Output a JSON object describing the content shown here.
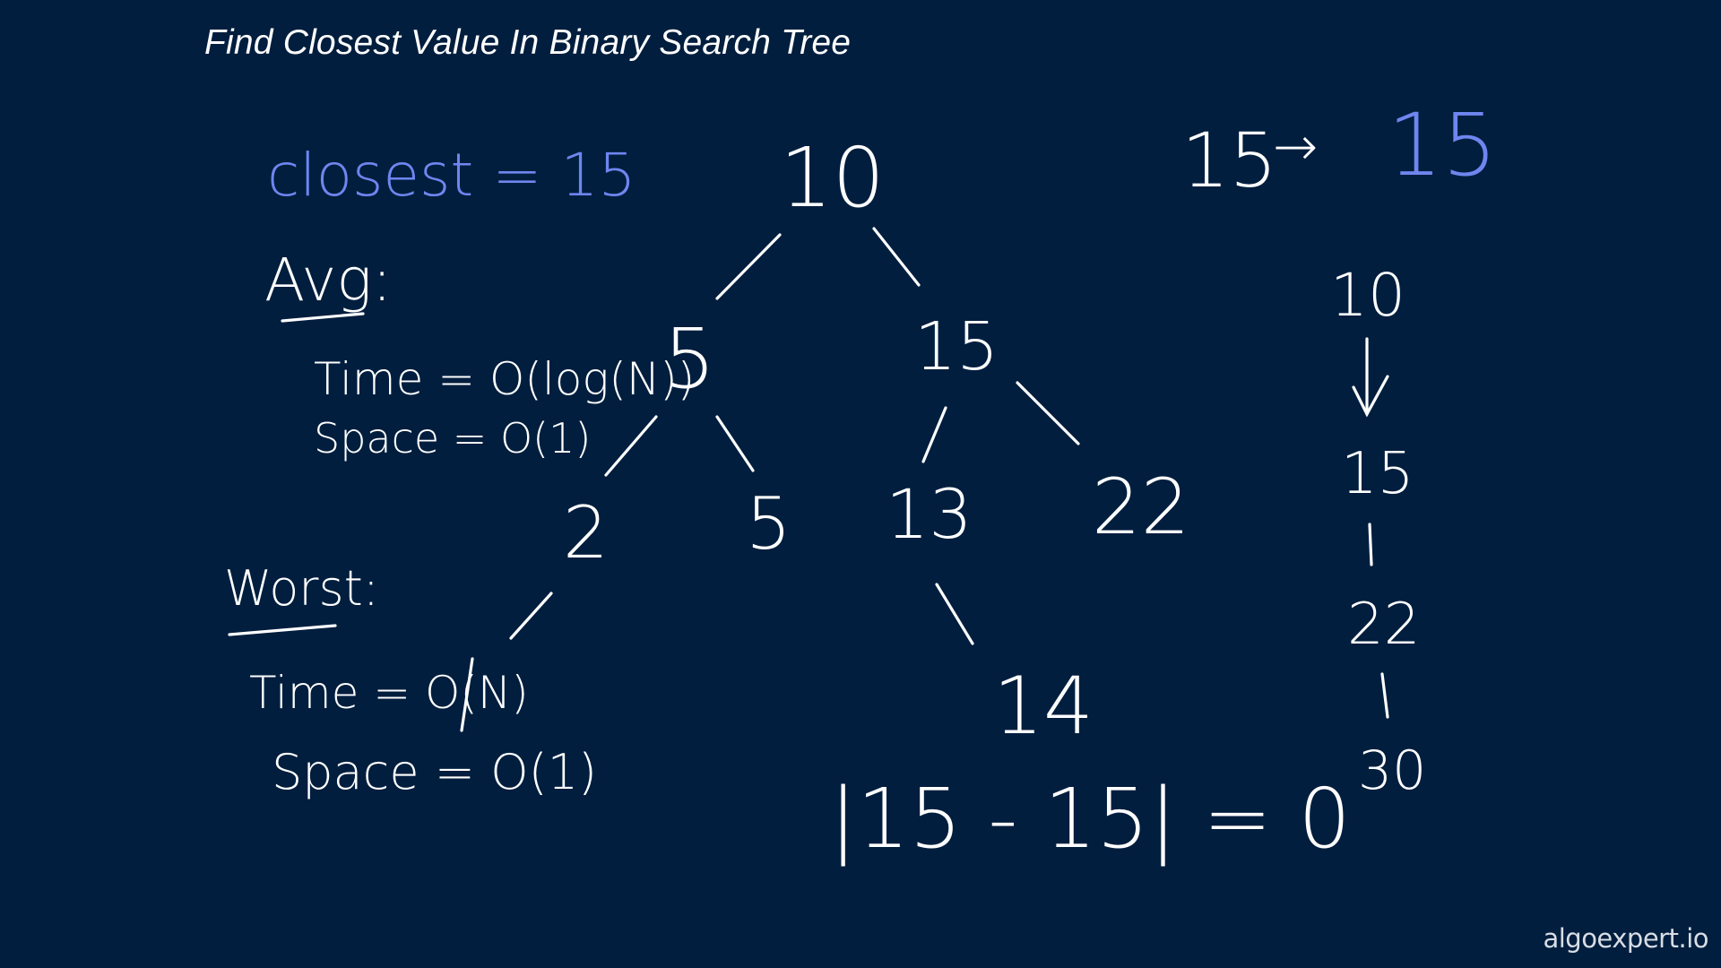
{
  "title": "Find Closest Value In Binary Search Tree",
  "watermark": "algoexpert.io",
  "colors": {
    "background": "#011e3e",
    "ink": "#ffffff",
    "accent": "#6f86f0"
  },
  "closest": {
    "label": "closest = 15"
  },
  "target": {
    "left": "15",
    "arrow": "→",
    "right": "15"
  },
  "average": {
    "heading": "Avg:",
    "time": "Time = O(log(N))",
    "space": "Space = O(1)"
  },
  "worst": {
    "heading": "Worst:",
    "time": "Time = O(N)",
    "space": "Space = O(1)"
  },
  "tree": {
    "nodes": {
      "root": "10",
      "left": "5",
      "right": "15",
      "left_left": "2",
      "left_right": "5",
      "right_left": "13",
      "right_right": "22",
      "right_left_right": "14"
    }
  },
  "difference": "|15 - 15| = 0",
  "path": {
    "steps": [
      "10",
      "15",
      "22",
      "30"
    ]
  }
}
